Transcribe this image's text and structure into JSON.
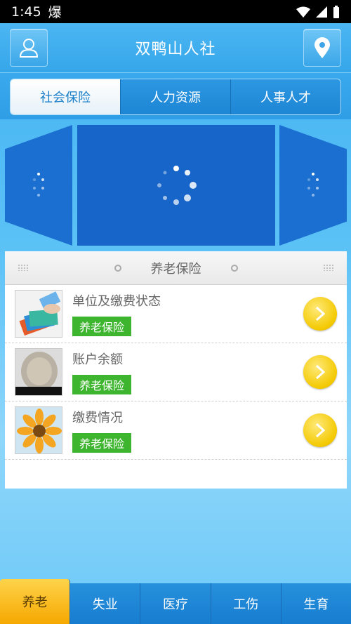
{
  "status": {
    "time": "1:45",
    "extra": "爆"
  },
  "header": {
    "title": "双鸭山人社"
  },
  "tabs": [
    {
      "label": "社会保险",
      "active": true
    },
    {
      "label": "人力资源",
      "active": false
    },
    {
      "label": "人事人才",
      "active": false
    }
  ],
  "section": {
    "title": "养老保险"
  },
  "items": [
    {
      "name": "单位及缴费状态",
      "badge": "养老保险"
    },
    {
      "name": "账户余额",
      "badge": "养老保险"
    },
    {
      "name": "缴费情况",
      "badge": "养老保险"
    }
  ],
  "bottom_nav": [
    {
      "label": "养老",
      "active": true
    },
    {
      "label": "失业",
      "active": false
    },
    {
      "label": "医疗",
      "active": false
    },
    {
      "label": "工伤",
      "active": false
    },
    {
      "label": "生育",
      "active": false
    }
  ],
  "colors": {
    "accent": "#1a7fc8",
    "badge": "#3db52e",
    "active_nav": "#f5a800"
  }
}
